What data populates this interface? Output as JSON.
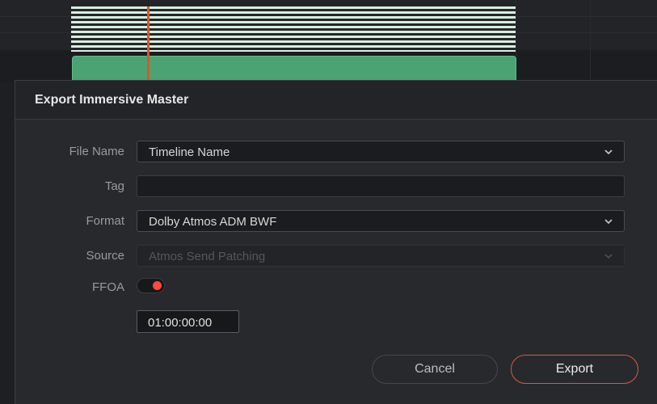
{
  "dialog": {
    "title": "Export Immersive Master",
    "fields": {
      "file_name": {
        "label": "File Name",
        "value": "Timeline Name"
      },
      "tag": {
        "label": "Tag",
        "value": ""
      },
      "format": {
        "label": "Format",
        "value": "Dolby Atmos ADM BWF"
      },
      "source": {
        "label": "Source",
        "value": "Atmos Send Patching"
      },
      "ffoa": {
        "label": "FFOA",
        "enabled": true,
        "timecode": "01:00:00:00"
      }
    },
    "buttons": {
      "cancel": "Cancel",
      "export": "Export"
    }
  },
  "colors": {
    "clip": "#4ba374",
    "playhead": "#d9552f",
    "toggle_on": "#ff4a3a",
    "export_border": "#d55a44"
  },
  "icons": {
    "dropdown": "chevron-down-icon"
  }
}
